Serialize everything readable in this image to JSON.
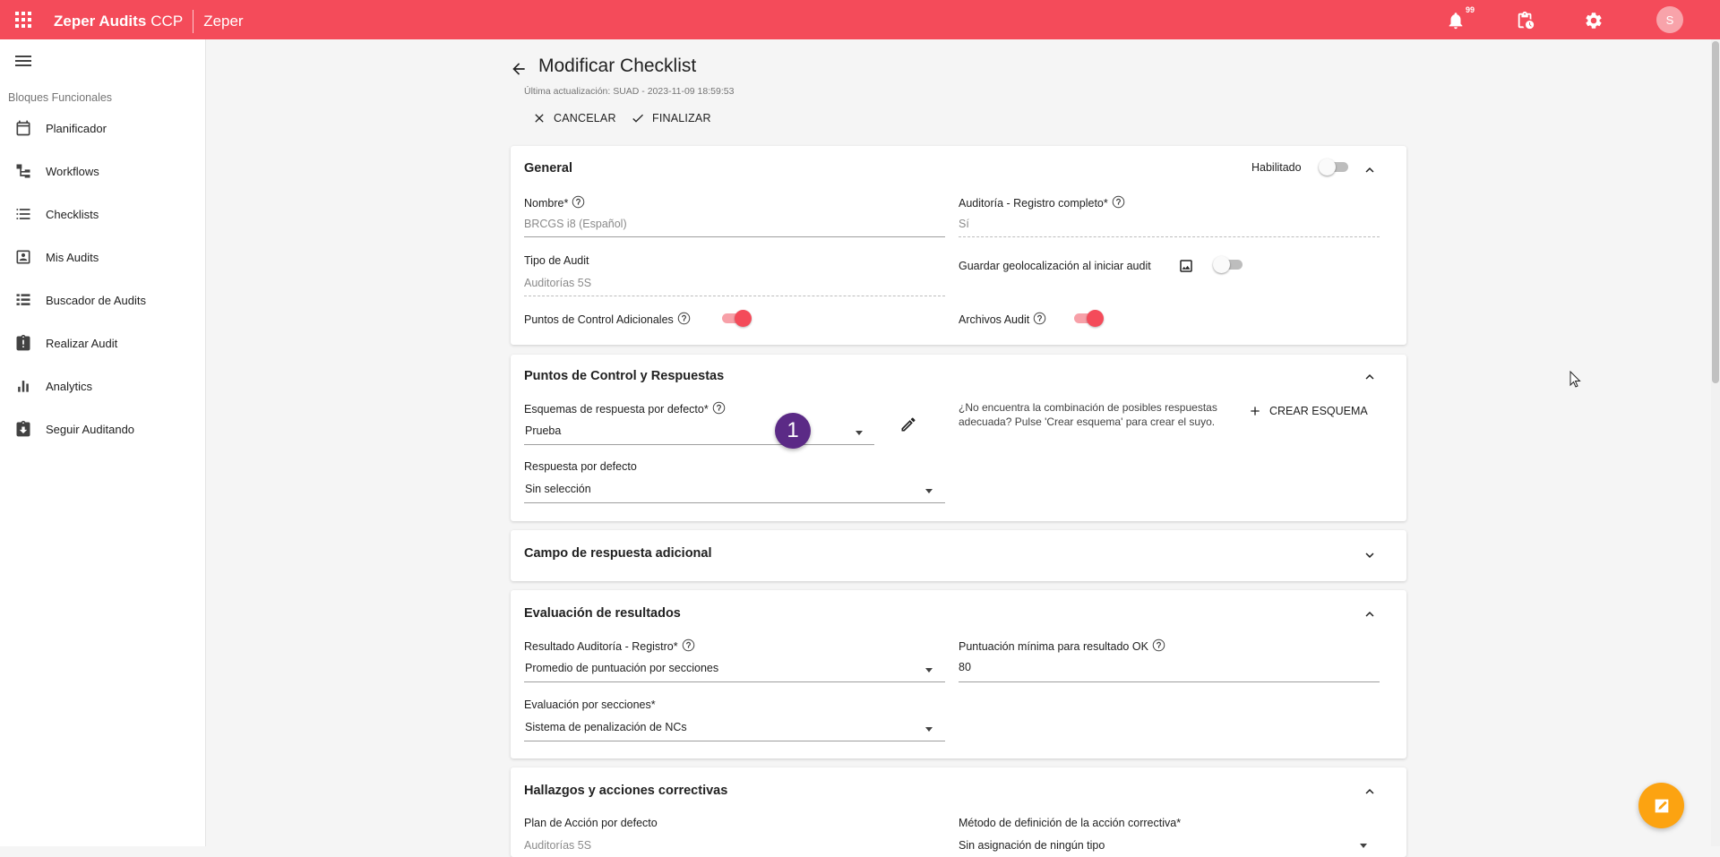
{
  "topbar": {
    "app_name": "Zeper Audits",
    "app_suffix": "CCP",
    "org": "Zeper",
    "notification_count": "99",
    "avatar_initial": "S",
    "color": "#f44b5a"
  },
  "sidebar": {
    "section_title": "Bloques Funcionales",
    "items": [
      {
        "label": "Planificador",
        "icon": "calendar-icon"
      },
      {
        "label": "Workflows",
        "icon": "workflow-icon"
      },
      {
        "label": "Checklists",
        "icon": "list-icon"
      },
      {
        "label": "Mis Audits",
        "icon": "contact-icon"
      },
      {
        "label": "Buscador de Audits",
        "icon": "list-view-icon"
      },
      {
        "label": "Realizar Audit",
        "icon": "clipboard-icon"
      },
      {
        "label": "Analytics",
        "icon": "bar-chart-icon"
      },
      {
        "label": "Seguir Auditando",
        "icon": "clipboard-download-icon"
      }
    ]
  },
  "page": {
    "title": "Modificar Checklist",
    "last_update": "Última actualización: SUAD - 2023-11-09 18:59:53",
    "cancel_label": "CANCELAR",
    "finish_label": "FINALIZAR"
  },
  "general": {
    "title": "General",
    "enabled_label": "Habilitado",
    "enabled": false,
    "name_label": "Nombre*",
    "name_value": "BRCGS i8 (Español)",
    "full_record_label": "Auditoría - Registro completo*",
    "full_record_value": "Sí",
    "audit_type_label": "Tipo de Audit",
    "audit_type_value": "Auditorías 5S",
    "geo_label": "Guardar geolocalización al iniciar audit",
    "geo_enabled": false,
    "extra_points_label": "Puntos de Control Adicionales",
    "extra_points_enabled": true,
    "audit_files_label": "Archivos Audit",
    "audit_files_enabled": true
  },
  "control_points": {
    "title": "Puntos de Control y Respuestas",
    "schema_label": "Esquemas de respuesta por defecto*",
    "schema_value": "Prueba",
    "default_answer_label": "Respuesta por defecto",
    "default_answer_value": "Sin selección",
    "hint": "¿No encuentra la combinación de posibles respuestas adecuada? Pulse 'Crear esquema' para crear el suyo.",
    "create_label": "CREAR ESQUEMA",
    "step_marker": "1"
  },
  "additional_field": {
    "title": "Campo de respuesta adicional"
  },
  "evaluation": {
    "title": "Evaluación de resultados",
    "result_label": "Resultado Auditoría - Registro*",
    "result_value": "Promedio de puntuación por secciones",
    "min_score_label": "Puntuación mínima para resultado OK",
    "min_score_value": "80",
    "section_eval_label": "Evaluación por secciones*",
    "section_eval_value": "Sistema de penalización de NCs"
  },
  "findings": {
    "title": "Hallazgos y acciones correctivas",
    "action_plan_label": "Plan de Acción por defecto",
    "action_plan_value": "Auditorías 5S",
    "method_label": "Método de definición de la acción correctiva*",
    "method_value": "Sin asignación de ningún tipo"
  }
}
